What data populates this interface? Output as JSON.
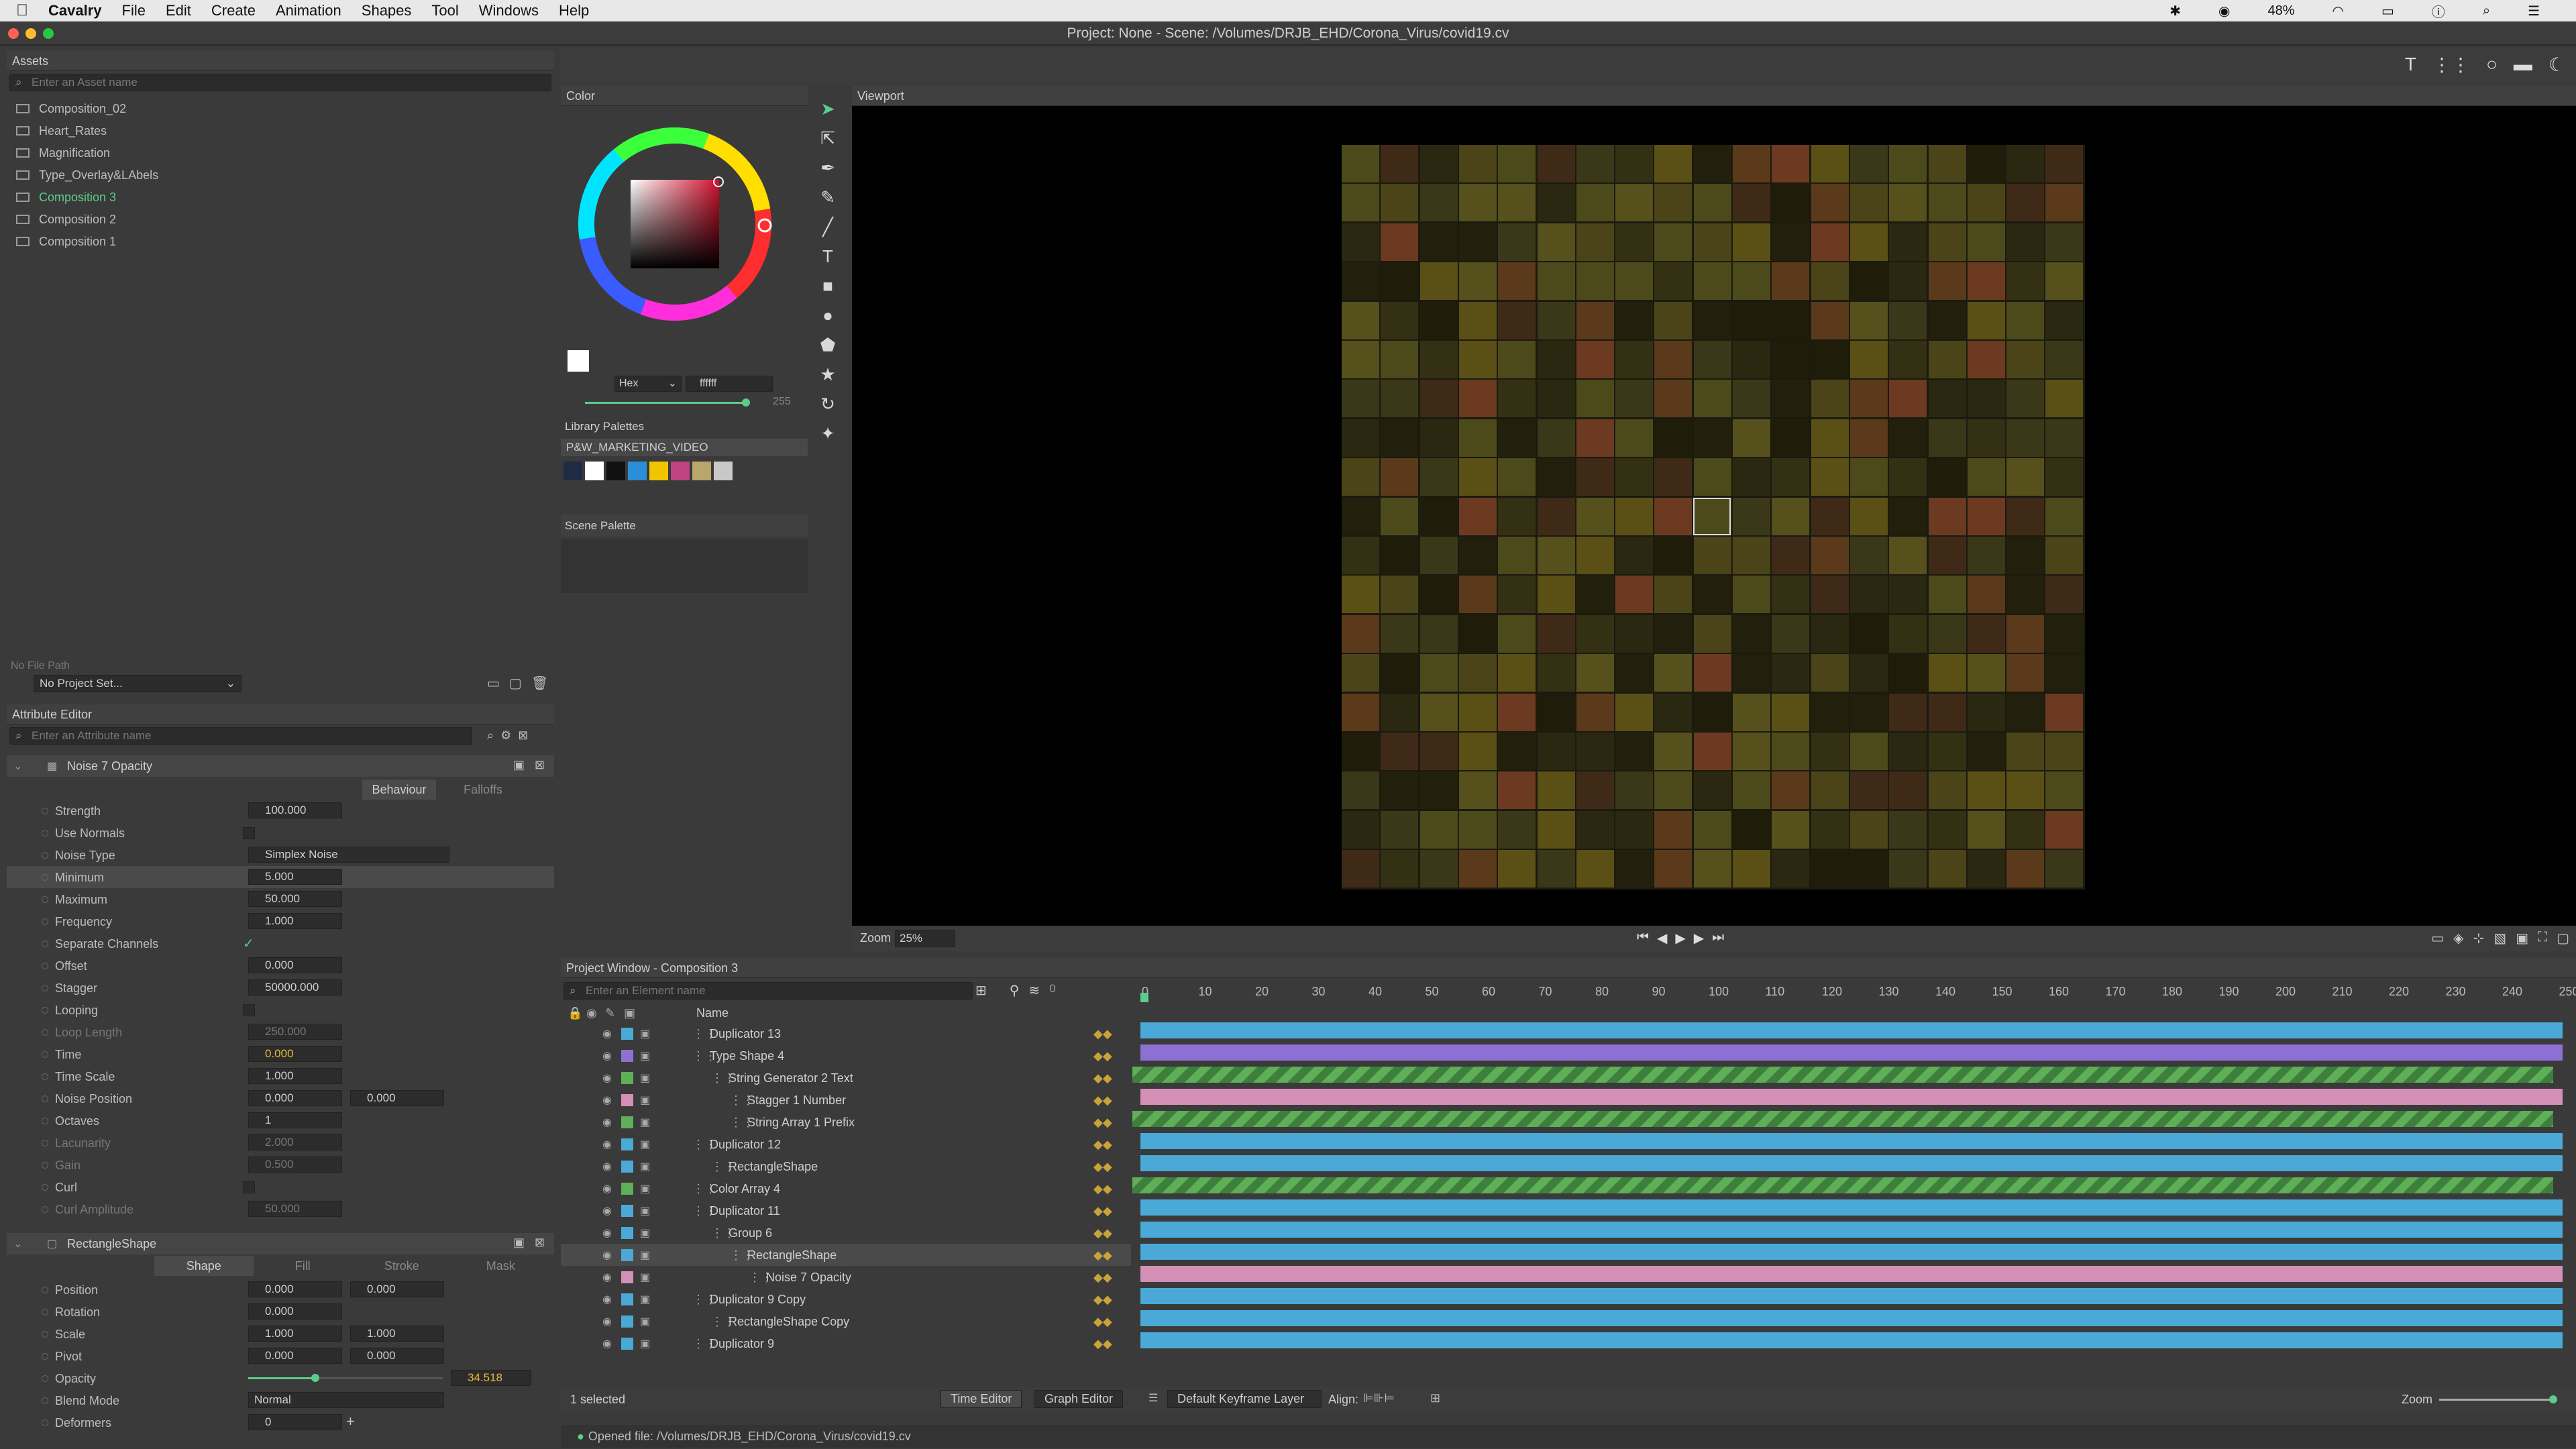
{
  "menubar": {
    "app": "Cavalry",
    "items": [
      "File",
      "Edit",
      "Create",
      "Animation",
      "Shapes",
      "Tool",
      "Windows",
      "Help"
    ],
    "battery": "48%"
  },
  "title": "Project: None - Scene: /Volumes/DRJB_EHD/Corona_Virus/covid19.cv",
  "assets": {
    "header": "Assets",
    "search_placeholder": "Enter an Asset name",
    "items": [
      "Composition_02",
      "Heart_Rates",
      "Magnification",
      "Type_Overlay&LAbels",
      "Composition 3",
      "Composition 2",
      "Composition 1"
    ],
    "active_index": 4,
    "file_path": "No File Path",
    "project_set": "No Project Set..."
  },
  "attribute_editor": {
    "header": "Attribute Editor",
    "search_placeholder": "Enter an Attribute name",
    "noise": {
      "title": "Noise 7 Opacity",
      "tab_behaviour": "Behaviour",
      "tab_falloffs": "Falloffs",
      "rows": [
        {
          "label": "Strength",
          "value": "100.000"
        },
        {
          "label": "Use Normals",
          "value": ""
        },
        {
          "label": "Noise Type",
          "value": "Simplex Noise"
        },
        {
          "label": "Minimum",
          "value": "5.000"
        },
        {
          "label": "Maximum",
          "value": "50.000"
        },
        {
          "label": "Frequency",
          "value": "1.000"
        },
        {
          "label": "Separate Channels",
          "value": "✓"
        },
        {
          "label": "Offset",
          "value": "0.000"
        },
        {
          "label": "Stagger",
          "value": "50000.000"
        },
        {
          "label": "Looping",
          "value": ""
        },
        {
          "label": "Loop Length",
          "value": "250.000"
        },
        {
          "label": "Time",
          "value": "0.000"
        },
        {
          "label": "Time Scale",
          "value": "1.000"
        },
        {
          "label": "Noise Position",
          "value": "0.000",
          "value2": "0.000"
        },
        {
          "label": "Octaves",
          "value": "1"
        },
        {
          "label": "Lacunarity",
          "value": "2.000"
        },
        {
          "label": "Gain",
          "value": "0.500"
        },
        {
          "label": "Curl",
          "value": ""
        },
        {
          "label": "Curl Amplitude",
          "value": "50.000"
        }
      ]
    },
    "shape": {
      "title": "RectangleShape",
      "tabs": [
        "Shape",
        "Fill",
        "Stroke",
        "Mask"
      ],
      "rows": [
        {
          "label": "Position",
          "value": "0.000",
          "value2": "0.000"
        },
        {
          "label": "Rotation",
          "value": "0.000"
        },
        {
          "label": "Scale",
          "value": "1.000",
          "value2": "1.000"
        },
        {
          "label": "Pivot",
          "value": "0.000",
          "value2": "0.000"
        },
        {
          "label": "Opacity",
          "value": "34.518"
        },
        {
          "label": "Blend Mode",
          "value": "Normal"
        },
        {
          "label": "Deformers",
          "value": "0"
        }
      ]
    }
  },
  "color": {
    "header": "Color",
    "mode": "Hex",
    "hex": "ffffff",
    "alpha": "255",
    "library_header": "Library Palettes",
    "palette_name": "P&W_MARKETING_VIDEO",
    "swatches": [
      "#1f2a44",
      "#ffffff",
      "#111111",
      "#2a8fd6",
      "#f0c400",
      "#c0447f",
      "#b9a66b",
      "#c8c8c8"
    ],
    "scene_header": "Scene Palette"
  },
  "viewport": {
    "header": "Viewport",
    "zoom_label": "Zoom",
    "zoom": "25%"
  },
  "project_window": {
    "header": "Project Window - Composition 3",
    "search_placeholder": "Enter an Element name",
    "frame": "0",
    "name_col": "Name",
    "layers": [
      {
        "name": "Duplicator 13",
        "indent": 0,
        "color": "#4aa9d6",
        "bar": "#4aa9d6"
      },
      {
        "name": "Type Shape 4",
        "indent": 0,
        "color": "#8e6fd2",
        "bar": "#8e6fd2"
      },
      {
        "name": "String Generator 2 Text",
        "indent": 1,
        "color": "#5fae58",
        "bar": "#5fae58"
      },
      {
        "name": "Stagger 1 Number",
        "indent": 2,
        "color": "#d38fb5",
        "bar": "#d38fb5"
      },
      {
        "name": "String Array 1 Prefix",
        "indent": 2,
        "color": "#5fae58",
        "bar": "#5fae58"
      },
      {
        "name": "Duplicator 12",
        "indent": 0,
        "color": "#4aa9d6",
        "bar": "#4aa9d6"
      },
      {
        "name": "RectangleShape",
        "indent": 1,
        "color": "#4aa9d6",
        "bar": "#4aa9d6"
      },
      {
        "name": "Color Array 4",
        "indent": 0,
        "color": "#5fae58",
        "bar": "#5fae58"
      },
      {
        "name": "Duplicator 11",
        "indent": 0,
        "color": "#4aa9d6",
        "bar": "#4aa9d6"
      },
      {
        "name": "Group 6",
        "indent": 1,
        "color": "#4aa9d6",
        "bar": "#4aa9d6"
      },
      {
        "name": "RectangleShape",
        "indent": 2,
        "color": "#4aa9d6",
        "bar": "#4aa9d6"
      },
      {
        "name": "Noise 7 Opacity",
        "indent": 3,
        "color": "#d38fb5",
        "bar": "#d38fb5"
      },
      {
        "name": "Duplicator 9 Copy",
        "indent": 0,
        "color": "#4aa9d6",
        "bar": "#4aa9d6"
      },
      {
        "name": "RectangleShape Copy",
        "indent": 1,
        "color": "#4aa9d6",
        "bar": "#4aa9d6"
      },
      {
        "name": "Duplicator 9",
        "indent": 0,
        "color": "#4aa9d6",
        "bar": "#4aa9d6"
      }
    ],
    "selected": "1 selected",
    "time_editor": "Time Editor",
    "graph_editor": "Graph Editor",
    "keyframe_layer": "Default Keyframe Layer",
    "align": "Align:",
    "zoom": "Zoom",
    "ticks": [
      "0",
      "10",
      "20",
      "30",
      "40",
      "50",
      "60",
      "70",
      "80",
      "90",
      "100",
      "110",
      "120",
      "130",
      "140",
      "150",
      "160",
      "170",
      "180",
      "190",
      "200",
      "210",
      "220",
      "230",
      "240",
      "250"
    ]
  },
  "status": "Opened file: /Volumes/DRJB_EHD/Corona_Virus/covid19.cv"
}
